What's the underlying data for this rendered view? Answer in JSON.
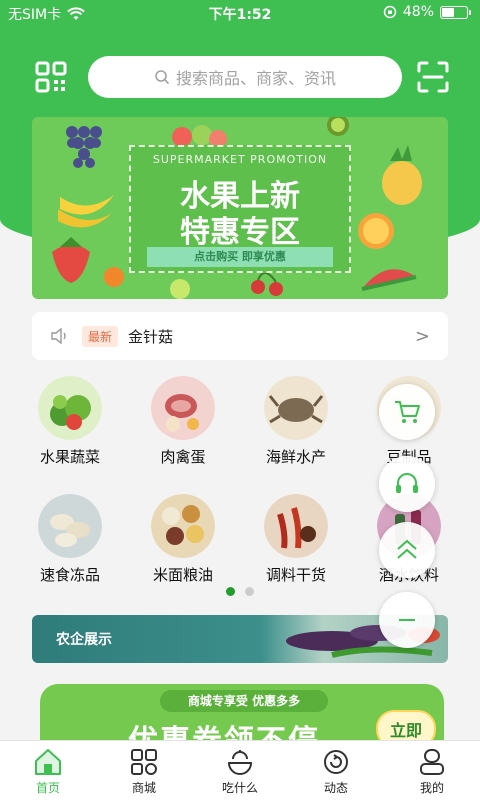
{
  "status_bar": {
    "carrier": "无SIM卡",
    "time": "下午1:52",
    "battery": "48%",
    "battery_level": 0.48
  },
  "header": {
    "search_placeholder": "搜索商品、商家、资讯"
  },
  "banner": {
    "subtitle": "SUPERMARKET PROMOTION",
    "title_line1": "水果上新",
    "title_line2": "特惠专区",
    "cta": "点击购买  即享优惠"
  },
  "notice": {
    "tag": "最新",
    "text": "金针菇",
    "chevron": ">"
  },
  "categories": [
    {
      "label": "水果蔬菜",
      "icon": "vegetables-photo",
      "color": "#5f9e3a"
    },
    {
      "label": "肉禽蛋",
      "icon": "meat-eggs-photo",
      "color": "#c9686a"
    },
    {
      "label": "海鲜水产",
      "icon": "crab-photo",
      "color": "#8b7a62"
    },
    {
      "label": "豆制品",
      "icon": "tofu-photo",
      "color": "#d9c7a8"
    },
    {
      "label": "速食冻品",
      "icon": "dumplings-photo",
      "color": "#d8d1c0"
    },
    {
      "label": "米面粮油",
      "icon": "grains-photo",
      "color": "#c7a56a"
    },
    {
      "label": "调料干货",
      "icon": "spices-photo",
      "color": "#8f3a2a"
    },
    {
      "label": "酒水饮料",
      "icon": "drinks-photo",
      "color": "#b03c64"
    }
  ],
  "pager": {
    "count": 2,
    "active": 0
  },
  "agri": {
    "label": "农企展示"
  },
  "promo": {
    "tagline": "商城专享受 优惠多多",
    "headline": "优惠券领不停",
    "button": "立即"
  },
  "tabs": [
    {
      "label": "首页",
      "icon": "home-icon",
      "active": true
    },
    {
      "label": "商城",
      "icon": "mall-icon",
      "active": false
    },
    {
      "label": "吃什么",
      "icon": "food-icon",
      "active": false
    },
    {
      "label": "动态",
      "icon": "refresh-icon",
      "active": false
    },
    {
      "label": "我的",
      "icon": "profile-icon",
      "active": false
    }
  ],
  "colors": {
    "brand": "#3fbf52",
    "accent": "#1f9c2b",
    "tag_bg": "#ffe8de",
    "tag_text": "#e66c45"
  }
}
